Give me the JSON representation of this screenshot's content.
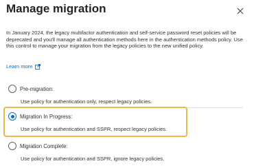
{
  "dialog": {
    "title": "Manage migration",
    "description": "In January 2024, the legacy multifactor authentication and self-service password reset policies will be deprecated and you'll manage all authentication methods here in the authentication methods policy. Use this control to manage your migration from the legacy policies to the new unified policy.",
    "learn_more": "Learn more",
    "close_icon": "close-icon",
    "external_link_icon": "external-link-icon"
  },
  "options": [
    {
      "label": "Pre-migration:",
      "description": "Use policy for authentication only, respect legacy policies.",
      "selected": false
    },
    {
      "label": "Migration In Progress:",
      "description": "Use policy for authentication and SSPR, respect legacy policies.",
      "selected": true
    },
    {
      "label": "Migration Complete:",
      "description": "Use policy for authentication and SSPR, ignore legacy policies.",
      "selected": false
    }
  ],
  "colors": {
    "accent": "#0f6cbd",
    "highlight_border": "#e8b84b",
    "text": "#323130"
  }
}
